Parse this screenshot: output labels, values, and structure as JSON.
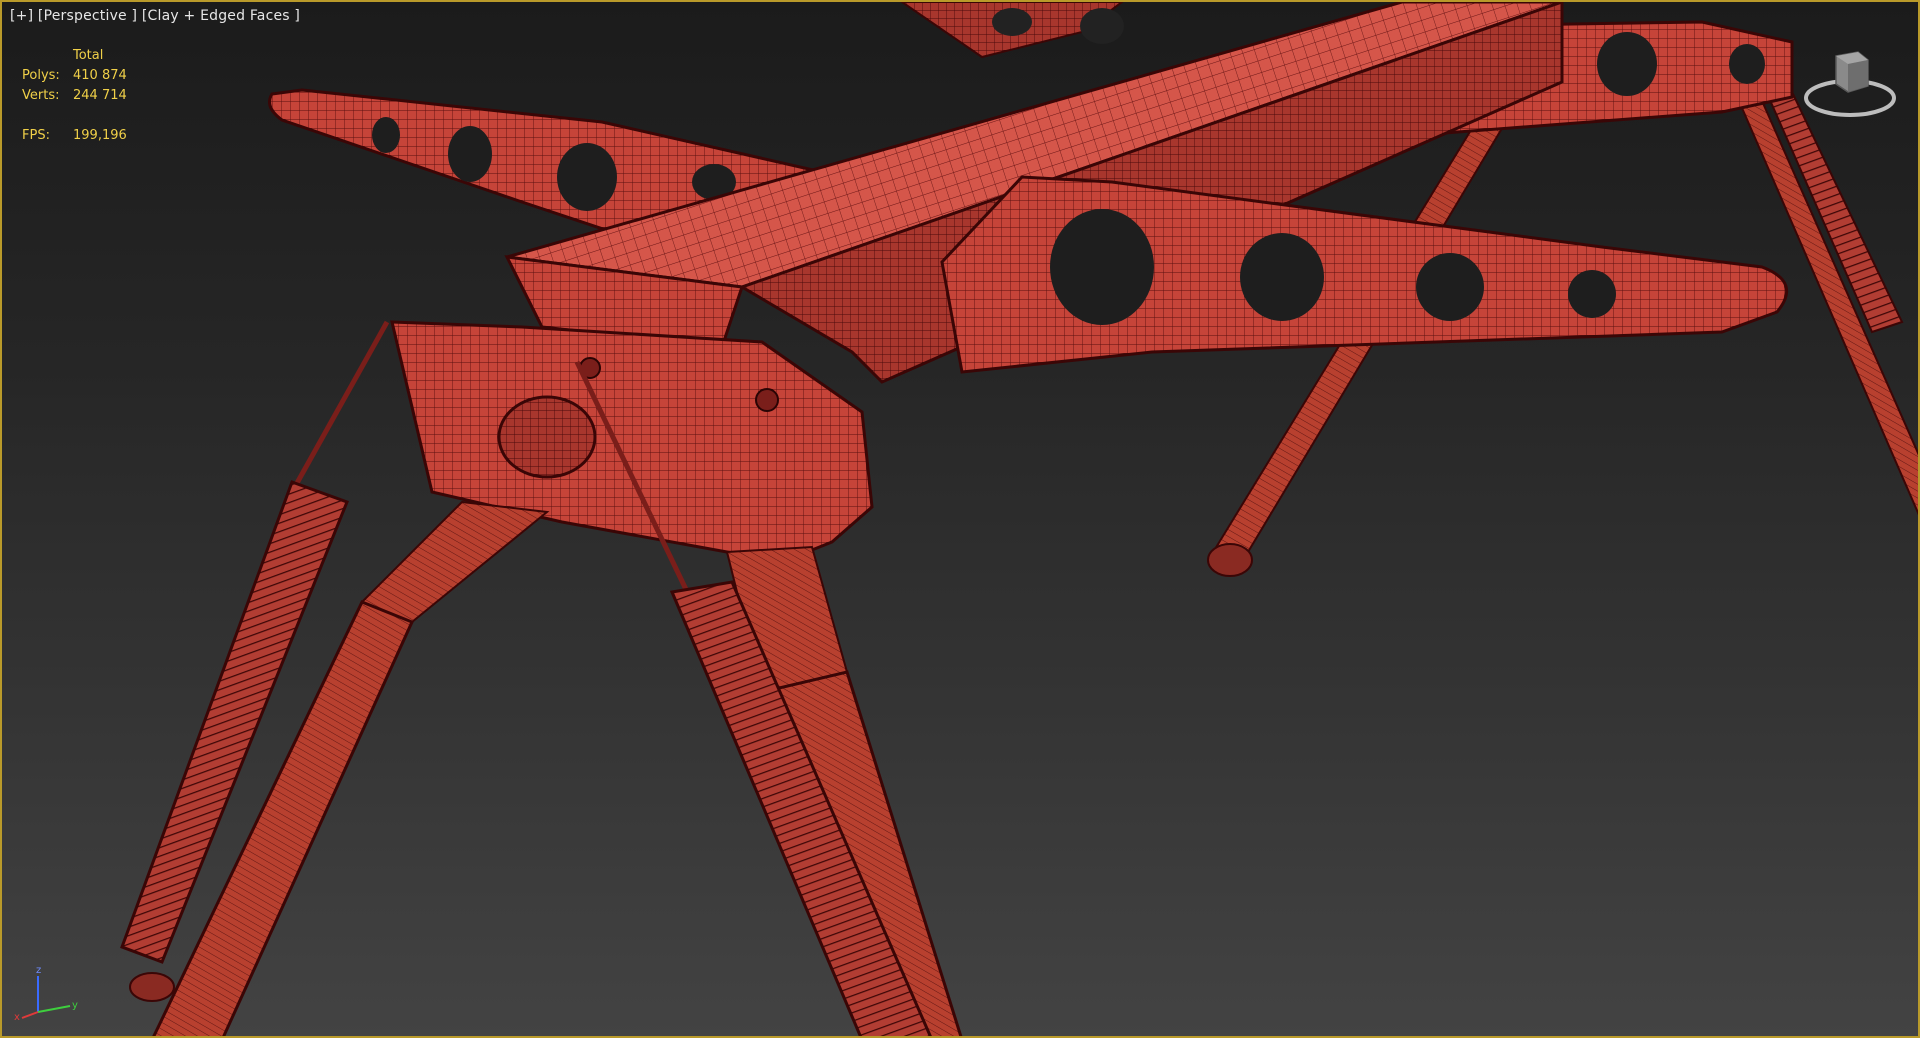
{
  "viewport": {
    "menu_label": "[+]",
    "view_label": "[Perspective ]",
    "shading_label": "[Clay + Edged Faces ]",
    "border_color": "#b99a2a",
    "model_color": "#c8463c",
    "wire_color": "#5a0f0f"
  },
  "stats": {
    "header": "Total",
    "polys_label": "Polys:",
    "polys_value": "410 874",
    "verts_label": "Verts:",
    "verts_value": "244 714",
    "fps_label": "FPS:",
    "fps_value": "199,196",
    "color": "#f0d048"
  },
  "viewcube": {
    "icon": "viewcube-icon"
  },
  "axis_gizmo": {
    "icon": "axis-tripod-icon",
    "z_label": "z",
    "x_label": "x",
    "y_label": "y"
  }
}
